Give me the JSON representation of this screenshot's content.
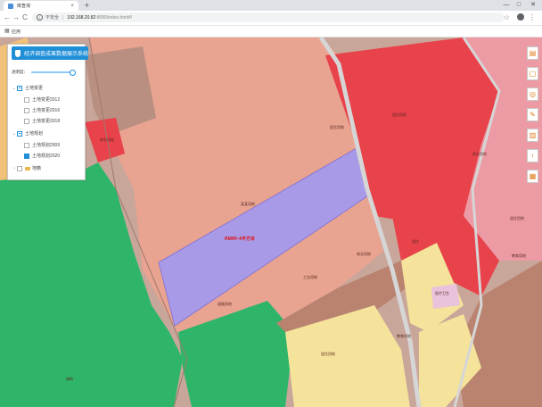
{
  "browser": {
    "tab_title": "库查询",
    "close_glyph": "×",
    "new_tab_glyph": "+",
    "back_glyph": "←",
    "forward_glyph": "→",
    "reload_glyph": "C",
    "security_label": "不安全",
    "url_host": "192.168.20.82",
    "url_rest": ":8080/index.html#/",
    "bookmarks_label": "应用",
    "star_glyph": "☆",
    "menu_glyph": "⋮",
    "window_controls": [
      "—",
      "□",
      "✕"
    ]
  },
  "panel": {
    "title": "经济调查成果数据展示系统",
    "opacity_label": "透明度：",
    "opacity_value": 1.0,
    "tree": [
      {
        "label": "土地变更",
        "level": 1,
        "state": "partial",
        "expanded": true
      },
      {
        "label": "土地变更2012",
        "level": 2,
        "state": "unchecked"
      },
      {
        "label": "土地变更2016",
        "level": 2,
        "state": "unchecked"
      },
      {
        "label": "土地变更2018",
        "level": 2,
        "state": "unchecked"
      },
      {
        "label": "土地规划",
        "level": 1,
        "state": "partial",
        "expanded": true
      },
      {
        "label": "土地规划2009",
        "level": 2,
        "state": "unchecked"
      },
      {
        "label": "土地规划2020",
        "level": 2,
        "state": "checked"
      },
      {
        "label": "地籍",
        "level": 1,
        "state": "unchecked",
        "expanded": false
      }
    ]
  },
  "toolbar": {
    "tools": [
      {
        "name": "layers-tool-icon",
        "glyph": "▤"
      },
      {
        "name": "clear-tool-icon",
        "glyph": "▢"
      },
      {
        "name": "locate-tool-icon",
        "glyph": "◎"
      },
      {
        "name": "measure-tool-icon",
        "glyph": "✎"
      },
      {
        "name": "delete-tool-icon",
        "glyph": "▥"
      },
      {
        "name": "upload-tool-icon",
        "glyph": "↑"
      },
      {
        "name": "chart-tool-icon",
        "glyph": "▦"
      }
    ]
  },
  "map": {
    "colors": {
      "residential_salmon": "#e8a391",
      "commercial_red": "#e8424b",
      "industrial_brown": "#b98370",
      "green_space": "#2fb569",
      "highlight_violet": "#a99ae8",
      "education_yellow": "#f5e39b",
      "road_gray": "#cfcfcf",
      "pink_zone": "#ec9aa4",
      "orange_zone": "#f0ae6a"
    },
    "labels": {
      "parcel_highlight": "RMHF-4平方米",
      "parcel_faint": "某某用地",
      "label_a": "商业用地",
      "label_b": "居住用地",
      "label_c": "居住用地",
      "label_d": "教育用地",
      "label_e": "居住用地",
      "label_f": "绿地",
      "label_g": "道路用地",
      "label_h": "商业用地",
      "label_i": "居住",
      "label_j": "工业用地",
      "label_k": "商业用地",
      "label_l": "医疗卫生",
      "label_m": "居住用地",
      "label_n": "教育用地"
    }
  }
}
